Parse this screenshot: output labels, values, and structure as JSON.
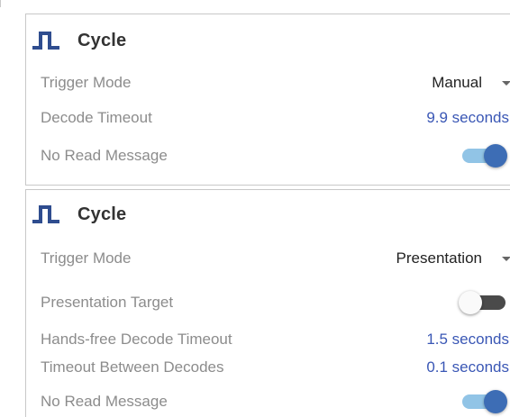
{
  "panels": [
    {
      "icon": "pulse-wave-icon",
      "title": "Cycle",
      "trigger_mode": {
        "label": "Trigger Mode",
        "value": "Manual"
      },
      "decode_timeout": {
        "label": "Decode Timeout",
        "value": "9.9 seconds"
      },
      "no_read_message": {
        "label": "No Read Message",
        "enabled": true
      }
    },
    {
      "icon": "pulse-wave-icon",
      "title": "Cycle",
      "trigger_mode": {
        "label": "Trigger Mode",
        "value": "Presentation"
      },
      "presentation_target": {
        "label": "Presentation Target",
        "enabled": false
      },
      "hands_free_decode_timeout": {
        "label": "Hands-free Decode Timeout",
        "value": "1.5 seconds"
      },
      "timeout_between_decodes": {
        "label": "Timeout Between Decodes",
        "value": "0.1 seconds"
      },
      "no_read_message": {
        "label": "No Read Message",
        "enabled": true
      }
    }
  ],
  "colors": {
    "accent": "#3a57b5",
    "toggle_on_track": "#91c4e6",
    "toggle_on_knob": "#3d6db5",
    "toggle_off_track": "#4a4a4a",
    "label_gray": "#8c8c8c"
  }
}
